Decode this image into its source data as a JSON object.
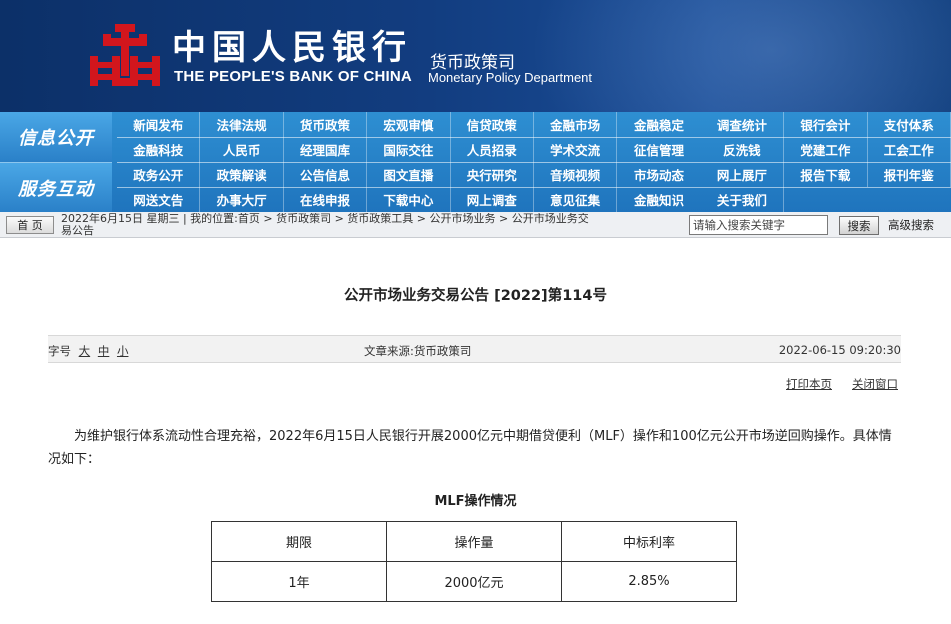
{
  "header": {
    "bank_name_cn": "中国人民银行",
    "bank_name_en": "THE PEOPLE'S BANK OF CHINA",
    "dept_cn": "货币政策司",
    "dept_en": "Monetary Policy Department",
    "colors": {
      "banner": "#123d80",
      "logo_red": "#d2161d",
      "nav": "#2681c8"
    }
  },
  "nav": {
    "sections": [
      "信息公开",
      "服务互动"
    ],
    "rows": [
      [
        "新闻发布",
        "法律法规",
        "货币政策",
        "宏观审慎",
        "信贷政策",
        "金融市场",
        "金融稳定",
        "调查统计",
        "银行会计",
        "支付体系"
      ],
      [
        "金融科技",
        "人民币",
        "经理国库",
        "国际交往",
        "人员招录",
        "学术交流",
        "征信管理",
        "反洗钱",
        "党建工作",
        "工会工作"
      ],
      [
        "政务公开",
        "政策解读",
        "公告信息",
        "图文直播",
        "央行研究",
        "音频视频",
        "市场动态",
        "网上展厅",
        "报告下载",
        "报刊年鉴"
      ],
      [
        "网送文告",
        "办事大厅",
        "在线申报",
        "下载中心",
        "网上调查",
        "意见征集",
        "金融知识",
        "关于我们"
      ]
    ]
  },
  "breadcrumb": {
    "home_label": "首 页",
    "line1": "2022年6月15日 星期三 | 我的位置:首页 > 货币政策司 > 货币政策工具 > 公开市场业务 > 公开市场业务交",
    "line2": "易公告",
    "search_placeholder": "请输入搜索关键字",
    "search_label": "搜索",
    "advanced_search_label": "高级搜索"
  },
  "article": {
    "title": "公开市场业务交易公告 [2022]第114号",
    "font_size_label": "字号",
    "font_sizes": [
      "大",
      "中",
      "小"
    ],
    "source": "文章来源:货币政策司",
    "date": "2022-06-15 09:20:30",
    "print_label": "打印本页",
    "close_label": "关闭窗口",
    "paragraph": "为维护银行体系流动性合理充裕，2022年6月15日人民银行开展2000亿元中期借贷便利（MLF）操作和100亿元公开市场逆回购操作。具体情况如下：",
    "table_caption": "MLF操作情况",
    "table": {
      "headers": [
        "期限",
        "操作量",
        "中标利率"
      ],
      "rows": [
        [
          "1年",
          "2000亿元",
          "2.85%"
        ]
      ]
    }
  }
}
